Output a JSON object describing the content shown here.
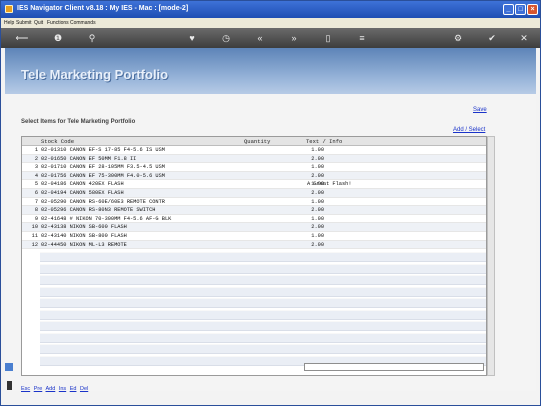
{
  "window": {
    "title": "IES Navigator Client v8.18 : My IES - Mac :    [mode-2]"
  },
  "menu": [
    "Help",
    "Submit",
    "Quit",
    "Functions",
    "Commands"
  ],
  "toolbar": {
    "icons": [
      "back-arrow-icon",
      "info-icon",
      "search-icon",
      "heart-icon",
      "clock-icon",
      "rewind-icon",
      "fast-forward-icon",
      "document-icon",
      "list-icon",
      "gear-icon",
      "check-icon",
      "close-icon"
    ],
    "glyphs": [
      "⟵",
      "❶",
      "⚲",
      "♥",
      "◷",
      "«",
      "»",
      "▯",
      "≡",
      "⚙",
      "✔",
      "✕"
    ]
  },
  "banner": {
    "title": "Tele Marketing Portfolio"
  },
  "links": {
    "save": "Save",
    "add_select": "Add / Select"
  },
  "section_title": "Select Items for Tele Marketing Portfolio",
  "grid": {
    "headers": {
      "code": "Stock Code",
      "qty": "Quantity",
      "text": "Text / Info"
    },
    "rows": [
      {
        "n": "1",
        "code": "02-01310 CANON EF-S 17-85 F4-5.6 IS USM",
        "qty": "1.00",
        "text": ""
      },
      {
        "n": "2",
        "code": "02-01650 CANON EF 50MM F1.8 II",
        "qty": "2.00",
        "text": ""
      },
      {
        "n": "3",
        "code": "02-01710 CANON EF 28-105MM F3.5-4.5 USM",
        "qty": "1.00",
        "text": ""
      },
      {
        "n": "4",
        "code": "02-01756 CANON EF 75-300MM F4.0-5.6 USM",
        "qty": "2.00",
        "text": ""
      },
      {
        "n": "5",
        "code": "02-04186 CANON 420EX FLASH",
        "qty": "1.00",
        "text": "A Great Flash!"
      },
      {
        "n": "6",
        "code": "02-04194 CANON 580EX FLASH",
        "qty": "2.00",
        "text": ""
      },
      {
        "n": "7",
        "code": "02-05290 CANON RS-60E/60E3 REMOTE CONTR",
        "qty": "1.00",
        "text": ""
      },
      {
        "n": "8",
        "code": "02-05296 CANON RS-80N3 REMOTE SWITCH",
        "qty": "2.00",
        "text": ""
      },
      {
        "n": "9",
        "code": "02-41648 # NIKON 70-300MM F4-5.6 AF-G BLK",
        "qty": "1.00",
        "text": ""
      },
      {
        "n": "10",
        "code": "02-43138 NIKON SB-600 FLASH",
        "qty": "2.00",
        "text": ""
      },
      {
        "n": "11",
        "code": "02-43140 NIKON SB-800 FLASH",
        "qty": "1.00",
        "text": ""
      },
      {
        "n": "12",
        "code": "02-44450 NIKON ML-L3 REMOTE",
        "qty": "2.00",
        "text": ""
      }
    ]
  },
  "footer": {
    "keys": [
      "Esc",
      "Pre",
      "Add",
      "Ins",
      "Ed",
      "Del"
    ]
  }
}
